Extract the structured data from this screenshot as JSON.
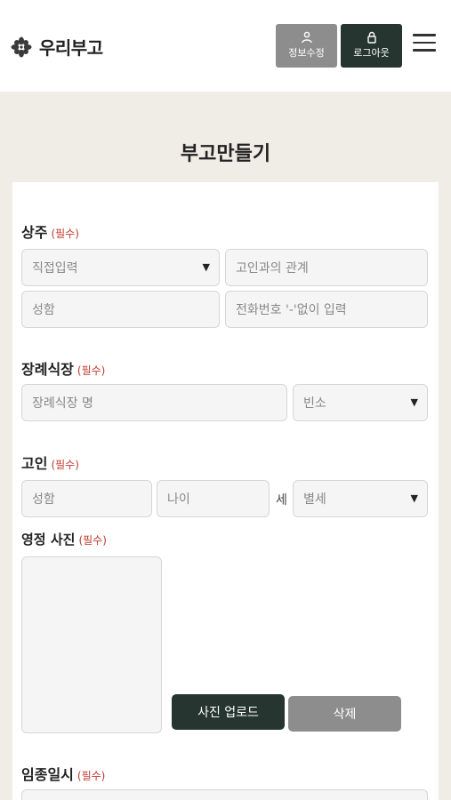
{
  "header": {
    "logo_text": "우리부고",
    "edit_label": "정보수정",
    "logout_label": "로그아웃",
    "edit_icon": "person-icon",
    "logout_icon": "lock-icon",
    "menu_icon": "hamburger-menu-icon"
  },
  "page": {
    "title": "부고만들기"
  },
  "required_label": "(필수)",
  "sections": {
    "chief_mourner": {
      "label": "상주",
      "direct_input_select": "직접입력",
      "relation_placeholder": "고인과의 관계",
      "name_placeholder": "성함",
      "phone_placeholder": "전화번호 '-'없이 입력"
    },
    "funeral_hall": {
      "label": "장례식장",
      "name_placeholder": "장례식장 명",
      "room_select": "빈소"
    },
    "deceased": {
      "label": "고인",
      "name_placeholder": "성함",
      "age_placeholder": "나이",
      "age_unit": "세",
      "title_select": "별세"
    },
    "portrait": {
      "label": "영정 사진",
      "upload_label": "사진 업로드",
      "delete_label": "삭제"
    },
    "death_time": {
      "label": "임종일시"
    }
  },
  "colors": {
    "dark_green": "#26352f",
    "gray_button": "#8d8d8d",
    "background": "#f0ede6",
    "required_red": "#c0392b"
  }
}
